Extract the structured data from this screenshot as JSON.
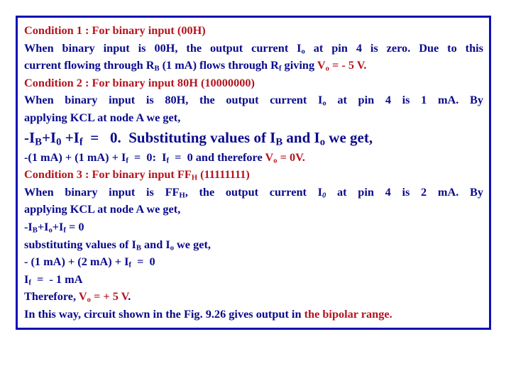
{
  "colors": {
    "border": "#0f0fb4",
    "text": "#0a0a8c",
    "highlight": "#b4141e",
    "background": "#ffffff"
  },
  "cond1": {
    "heading": "Condition 1  : For binary input (00H)",
    "l1_a": "When binary input is 00H, the output current I",
    "l1_sub": "o",
    "l1_b": " at pin 4 is zero. Due to this",
    "l2_a": "current flowing through R",
    "l2_sub1": "B",
    "l2_b": " (1 mA) flows through R",
    "l2_sub2": "f",
    "l2_c": " giving ",
    "l2_v": "V",
    "l2_vsub": "o",
    "l2_val": " = - 5 V."
  },
  "cond2": {
    "heading": "Condition 2 : For binary input 80H (10000000)",
    "l1_a": "When binary input is 80H, the output current I",
    "l1_sub": "o",
    "l1_b": " at pin 4 is 1 mA. By",
    "l2": "applying KCL at node A we get,",
    "eq_a": "-I",
    "eq_sub1": "B",
    "eq_b": "+I",
    "eq_sub2": "0",
    "eq_c": " +I",
    "eq_sub3": "f",
    "eq_d": "  =   0.  Substituting values of I",
    "eq_sub4": "B",
    "eq_e": " and I",
    "eq_sub5": "o",
    "eq_f": " we get,",
    "sub_a": "-(1 mA) + (1 mA) + I",
    "sub_sub1": "f",
    "sub_b": "  =  0:  I",
    "sub_sub2": "f",
    "sub_c": "  =  0 and therefore ",
    "sub_v": "V",
    "sub_vsub": "o",
    "sub_val": " = 0V."
  },
  "cond3": {
    "heading_a": "Condition 3 : For binary input FF",
    "heading_sub": "H",
    "heading_b": " (11111111)",
    "l1_a": "When binary input is FF",
    "l1_sub1": "H",
    "l1_b": ", the output current I",
    "l1_sub2": "0",
    "l1_c": " at pin 4 is 2 mA. By",
    "l2": "applying KCL at node A we get,",
    "eq_a": "-I",
    "eq_sub1": "B",
    "eq_b": "+I",
    "eq_sub2": "o",
    "eq_c": "+I",
    "eq_sub3": "f",
    "eq_d": " = 0",
    "subs_a": "substituting values of I",
    "subs_sub1": "B",
    "subs_b": " and I",
    "subs_sub2": "o",
    "subs_c": " we get,",
    "calc_a": "- (1 mA) + (2 mA) + I",
    "calc_sub": "f",
    "calc_b": "  =  0",
    "if_a": "I",
    "if_sub": "f",
    "if_b": "  =  - 1 mA",
    "there_a": "Therefore, ",
    "there_v": "V",
    "there_vsub": "o",
    "there_val": " = + 5 V",
    "there_dot": ".",
    "final_a": "In this way, circuit shown in the Fig. 9.26 gives output in ",
    "final_red": "the bipolar range."
  }
}
